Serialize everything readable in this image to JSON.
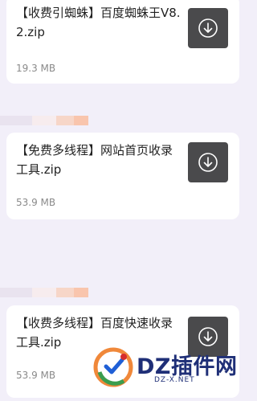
{
  "files": [
    {
      "name": "【收费引蜘蛛】百度蜘蛛王V8.2.zip",
      "size": "19.3 MB",
      "download_icon": "download-icon"
    },
    {
      "name": "【免费多线程】网站首页收录工具.zip",
      "size": "53.9 MB",
      "download_icon": "download-icon"
    },
    {
      "name": "【收费多线程】百度快速收录工具.zip",
      "size": "53.9 MB",
      "download_icon": "download-icon"
    }
  ],
  "watermark": {
    "brand": "DZ插件网",
    "url": "DZ-X.NET"
  },
  "colors": {
    "background": "#f2eff9",
    "card": "#ffffff",
    "button": "#4a4a4c",
    "brand": "#1f2f77"
  }
}
